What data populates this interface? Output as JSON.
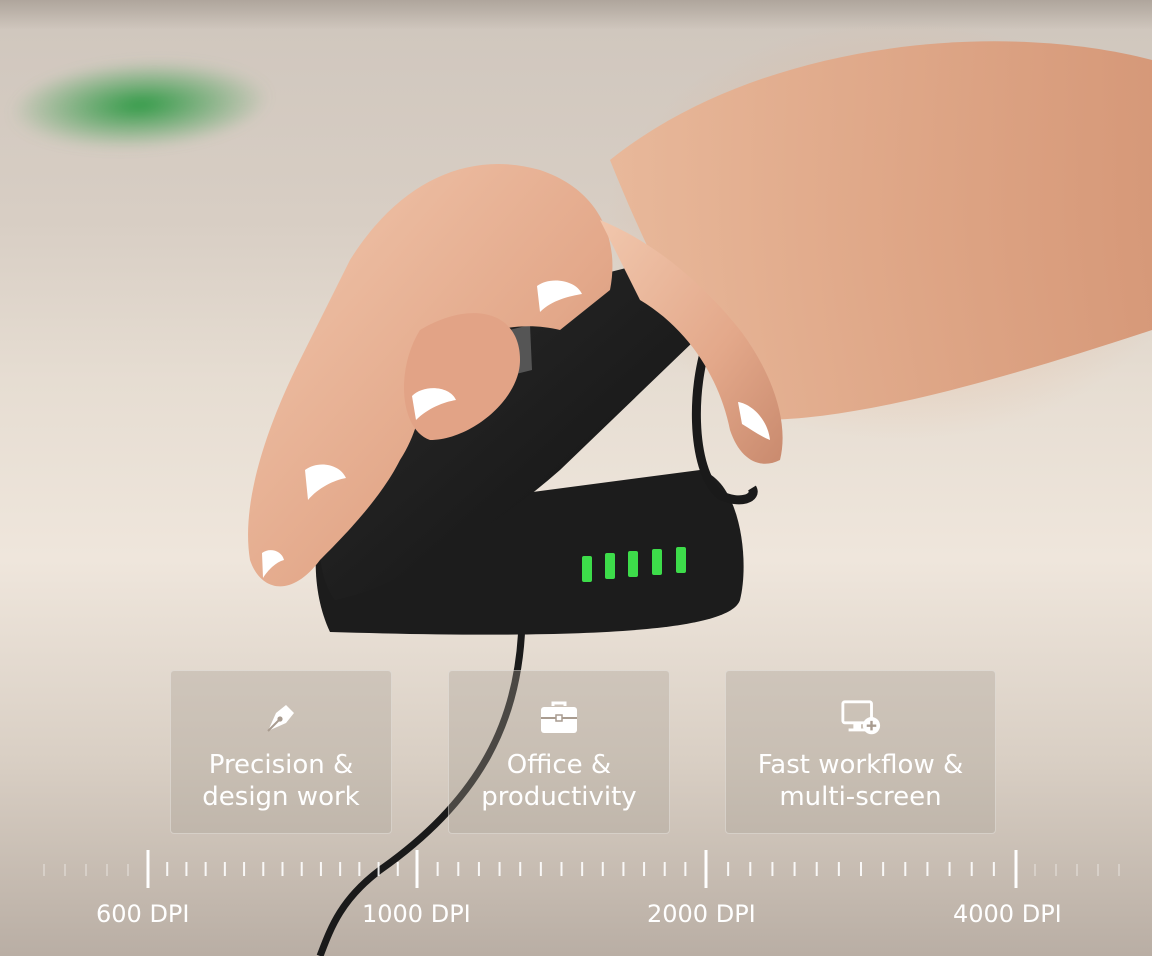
{
  "cards": [
    {
      "label_line1": "Precision &",
      "label_line2": "design work",
      "icon": "pen-nib-icon"
    },
    {
      "label_line1": "Office &",
      "label_line2": "productivity",
      "icon": "briefcase-icon"
    },
    {
      "label_line1": "Fast workflow &",
      "label_line2": "multi-screen",
      "icon": "monitor-add-icon"
    }
  ],
  "dpi_labels": [
    "600 DPI",
    "1000 DPI",
    "2000 DPI",
    "4000 DPI"
  ],
  "colors": {
    "card_text": "#ffffff",
    "led_green": "#3ddc4a"
  }
}
